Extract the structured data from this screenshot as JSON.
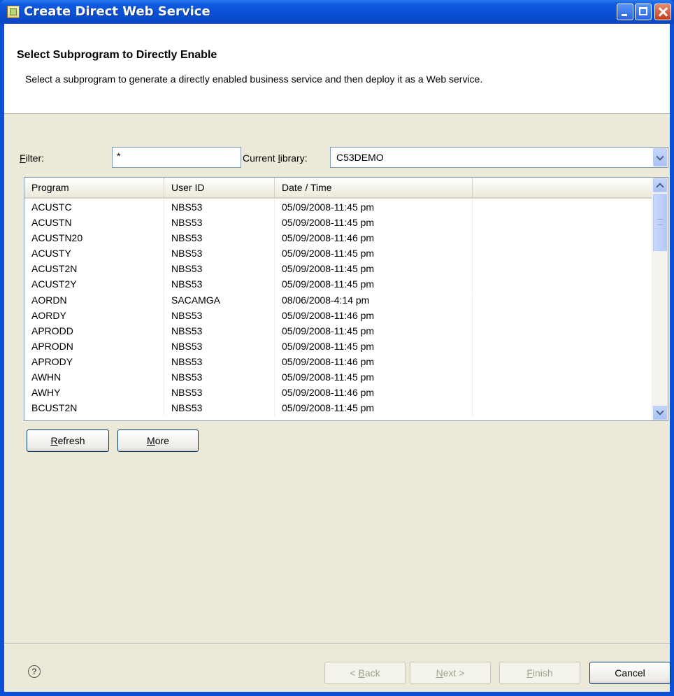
{
  "window": {
    "title": "Create Direct Web Service"
  },
  "header": {
    "title": "Select Subprogram to Directly Enable",
    "description": "Select a subprogram to generate a directly enabled business service and then deploy it as a Web service."
  },
  "filter": {
    "label_accel": "F",
    "label_rest": "ilter:",
    "value": "*"
  },
  "library": {
    "label_pre": "Current ",
    "label_accel": "l",
    "label_rest": "ibrary:",
    "value": "C53DEMO"
  },
  "table": {
    "columns": [
      "Program",
      "User ID",
      "Date / Time",
      ""
    ],
    "rows": [
      [
        "ACUSTC",
        "NBS53",
        "05/09/2008-11:45 pm"
      ],
      [
        "ACUSTN",
        "NBS53",
        "05/09/2008-11:45 pm"
      ],
      [
        "ACUSTN20",
        "NBS53",
        "05/09/2008-11:46 pm"
      ],
      [
        "ACUSTY",
        "NBS53",
        "05/09/2008-11:45 pm"
      ],
      [
        "ACUST2N",
        "NBS53",
        "05/09/2008-11:45 pm"
      ],
      [
        "ACUST2Y",
        "NBS53",
        "05/09/2008-11:45 pm"
      ],
      [
        "AORDN",
        "SACAMGA",
        "08/06/2008-4:14 pm"
      ],
      [
        "AORDY",
        "NBS53",
        "05/09/2008-11:46 pm"
      ],
      [
        "APRODD",
        "NBS53",
        "05/09/2008-11:45 pm"
      ],
      [
        "APRODN",
        "NBS53",
        "05/09/2008-11:45 pm"
      ],
      [
        "APRODY",
        "NBS53",
        "05/09/2008-11:46 pm"
      ],
      [
        "AWHN",
        "NBS53",
        "05/09/2008-11:45 pm"
      ],
      [
        "AWHY",
        "NBS53",
        "05/09/2008-11:46 pm"
      ],
      [
        "BCUST2N",
        "NBS53",
        "05/09/2008-11:45 pm"
      ]
    ]
  },
  "buttons": {
    "refresh_accel": "R",
    "refresh_rest": "efresh",
    "more_accel": "M",
    "more_rest": "ore",
    "back_pre": "< ",
    "back_accel": "B",
    "back_rest": "ack",
    "next_accel": "N",
    "next_rest": "ext >",
    "finish_accel": "F",
    "finish_rest": "inish",
    "cancel": "Cancel"
  },
  "help": {
    "glyph": "?"
  },
  "icons": {
    "app": "wizard-app-icon",
    "help": "help-icon",
    "combo": "chevron-down-icon"
  },
  "colors": {
    "titlebar": "#0a4fd4",
    "dialog_bg": "#ece9d8",
    "disabled_text": "#a1a192"
  }
}
